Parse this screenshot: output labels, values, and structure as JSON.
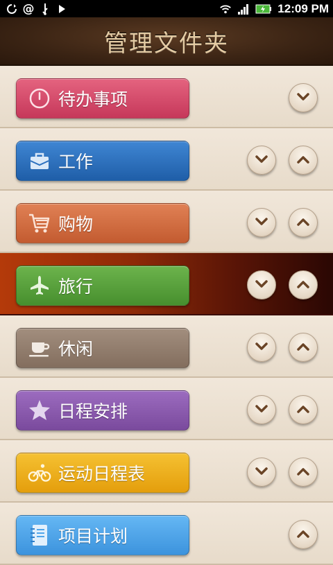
{
  "status_bar": {
    "time": "12:09 PM"
  },
  "header": {
    "title": "管理文件夹"
  },
  "folders": [
    {
      "label": "待办事项",
      "icon": "clock-icon",
      "color": "#d34b6a",
      "has_down": true,
      "has_up": false,
      "active": false
    },
    {
      "label": "工作",
      "icon": "briefcase-icon",
      "color": "#2b70bf",
      "has_down": true,
      "has_up": true,
      "active": false
    },
    {
      "label": "购物",
      "icon": "shopping-cart-icon",
      "color": "#d06a40",
      "has_down": true,
      "has_up": true,
      "active": false
    },
    {
      "label": "旅行",
      "icon": "airplane-icon",
      "color": "#5aa23d",
      "has_down": true,
      "has_up": true,
      "active": true
    },
    {
      "label": "休闲",
      "icon": "coffee-cup-icon",
      "color": "#927d6d",
      "has_down": true,
      "has_up": true,
      "active": false
    },
    {
      "label": "日程安排",
      "icon": "star-icon",
      "color": "#8a5aae",
      "has_down": true,
      "has_up": true,
      "active": false
    },
    {
      "label": "运动日程表",
      "icon": "bicycle-icon",
      "color": "#eeae1c",
      "has_down": true,
      "has_up": true,
      "active": false
    },
    {
      "label": "项目计划",
      "icon": "notebook-icon",
      "color": "#4fa5ea",
      "has_down": false,
      "has_up": true,
      "active": false
    }
  ]
}
